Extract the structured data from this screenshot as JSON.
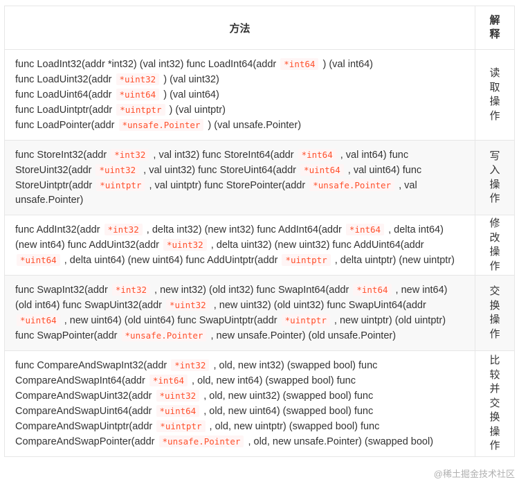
{
  "table": {
    "header": {
      "method": "方法",
      "explanation": [
        "解",
        "释"
      ]
    },
    "rows": [
      {
        "exp": [
          "读",
          "取",
          "操",
          "作"
        ],
        "segs": [
          "func LoadInt32(addr *int32) (val int32) func LoadInt64(addr ",
          "*int64",
          " ) (val int64)",
          "func LoadUint32(addr ",
          "*uint32",
          " ) (val uint32)",
          "func LoadUint64(addr ",
          "*uint64",
          " ) (val uint64)",
          "func LoadUintptr(addr ",
          "*uintptr",
          " ) (val uintptr)",
          "func LoadPointer(addr ",
          "*unsafe.Pointer",
          " ) (val unsafe.Pointer)"
        ]
      },
      {
        "exp": [
          "写",
          "入",
          "操",
          "作"
        ],
        "segs": [
          "func StoreInt32(addr ",
          "*int32",
          " , val int32) func StoreInt64(addr ",
          "*int64",
          " , val int64) func StoreUint32(addr ",
          "*uint32",
          " , val uint32) func StoreUint64(addr ",
          "*uint64",
          " , val uint64) func StoreUintptr(addr ",
          "*uintptr",
          " , val uintptr) func StorePointer(addr ",
          "*unsafe.Pointer",
          " , val unsafe.Pointer)"
        ]
      },
      {
        "exp": [
          "修",
          "改",
          "操",
          "作"
        ],
        "segs": [
          "func AddInt32(addr ",
          "*int32",
          " , delta int32) (new int32) func AddInt64(addr ",
          "*int64",
          " , delta int64) (new int64) func AddUint32(addr ",
          "*uint32",
          " , delta uint32) (new uint32) func AddUint64(addr ",
          "*uint64",
          " , delta uint64) (new uint64) func AddUintptr(addr ",
          "*uintptr",
          " , delta uintptr) (new uintptr)"
        ]
      },
      {
        "exp": [
          "交",
          "换",
          "操",
          "作"
        ],
        "segs": [
          "func SwapInt32(addr ",
          "*int32",
          " , new int32) (old int32) func SwapInt64(addr ",
          "*int64",
          " , new int64) (old int64) func SwapUint32(addr ",
          "*uint32",
          " , new uint32) (old uint32) func SwapUint64(addr ",
          "*uint64",
          " , new uint64) (old uint64) func SwapUintptr(addr ",
          "*uintptr",
          " , new uintptr) (old uintptr) func SwapPointer(addr ",
          "*unsafe.Pointer",
          " , new unsafe.Pointer) (old unsafe.Pointer)"
        ]
      },
      {
        "exp": [
          "比",
          "较",
          "并",
          "交",
          "换",
          "操",
          "作"
        ],
        "segs": [
          "func CompareAndSwapInt32(addr ",
          "*int32",
          " , old, new int32) (swapped bool) func CompareAndSwapInt64(addr ",
          "*int64",
          " , old, new int64) (swapped bool) func CompareAndSwapUint32(addr ",
          "*uint32",
          " , old, new uint32) (swapped bool) func CompareAndSwapUint64(addr ",
          "*uint64",
          " , old, new uint64) (swapped bool) func CompareAndSwapUintptr(addr ",
          "*uintptr",
          " , old, new uintptr) (swapped bool) func CompareAndSwapPointer(addr ",
          "*unsafe.Pointer",
          " , old, new unsafe.Pointer) (swapped bool)"
        ]
      }
    ]
  },
  "watermark": "@稀土掘金技术社区"
}
